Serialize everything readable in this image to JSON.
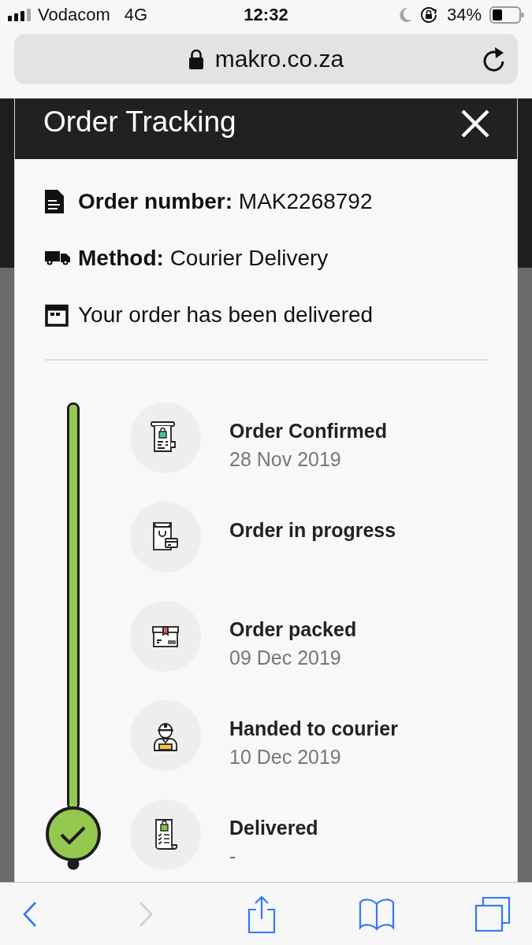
{
  "status_bar": {
    "carrier": "Vodacom",
    "network": "4G",
    "time": "12:32",
    "battery": "34%"
  },
  "address_bar": {
    "url": "makro.co.za"
  },
  "modal": {
    "title": "Order Tracking",
    "details": [
      {
        "kind": "order",
        "text": "**Order number:** MAK2268792"
      },
      {
        "kind": "method",
        "text": "**Method:** Courier Delivery"
      },
      {
        "kind": "status",
        "text": "Your order has been delivered"
      }
    ],
    "timeline": {
      "level": 1
    },
    "steps": [
      {
        "kind": "confirmed",
        "title": "Order Confirmed",
        "date": "28 Nov 2019"
      },
      {
        "kind": "progress",
        "title": "Order in progress"
      },
      {
        "kind": "packed",
        "title": "Order packed",
        "date": "09 Dec 2019"
      },
      {
        "kind": "courier",
        "title": "Handed to courier",
        "date": "10 Dec 2019"
      },
      {
        "kind": "delivered",
        "title": "Delivered",
        "date": "-"
      }
    ]
  },
  "toolbar": [
    {
      "kind": "back",
      "disabled": false
    },
    {
      "kind": "forward",
      "disabled": true
    },
    {
      "kind": "share",
      "disabled": false
    },
    {
      "kind": "bookmarks",
      "disabled": false
    },
    {
      "kind": "tabs",
      "disabled": false
    }
  ]
}
